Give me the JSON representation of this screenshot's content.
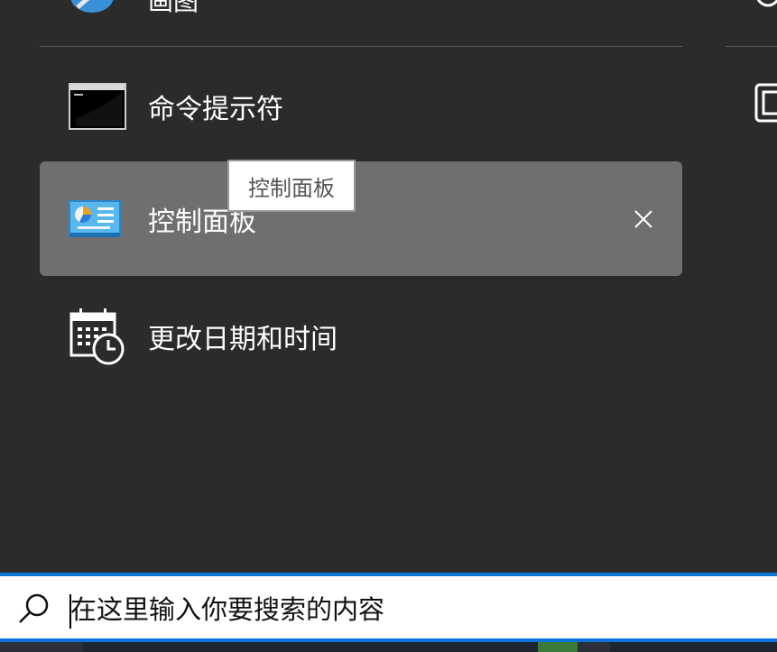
{
  "top_item": {
    "label": "画图"
  },
  "results": [
    {
      "label": "命令提示符",
      "icon": "cmd-icon"
    },
    {
      "label": "控制面板",
      "icon": "control-panel-icon",
      "selected": true
    },
    {
      "label": "更改日期和时间",
      "icon": "calendar-clock-icon"
    }
  ],
  "tooltip": {
    "text": "控制面板"
  },
  "search": {
    "placeholder": "在这里输入你要搜索的内容"
  },
  "colors": {
    "accent": "#0b74d8",
    "selected_bg": "#6f6f6f",
    "panel_bg": "#2b2b2b"
  }
}
